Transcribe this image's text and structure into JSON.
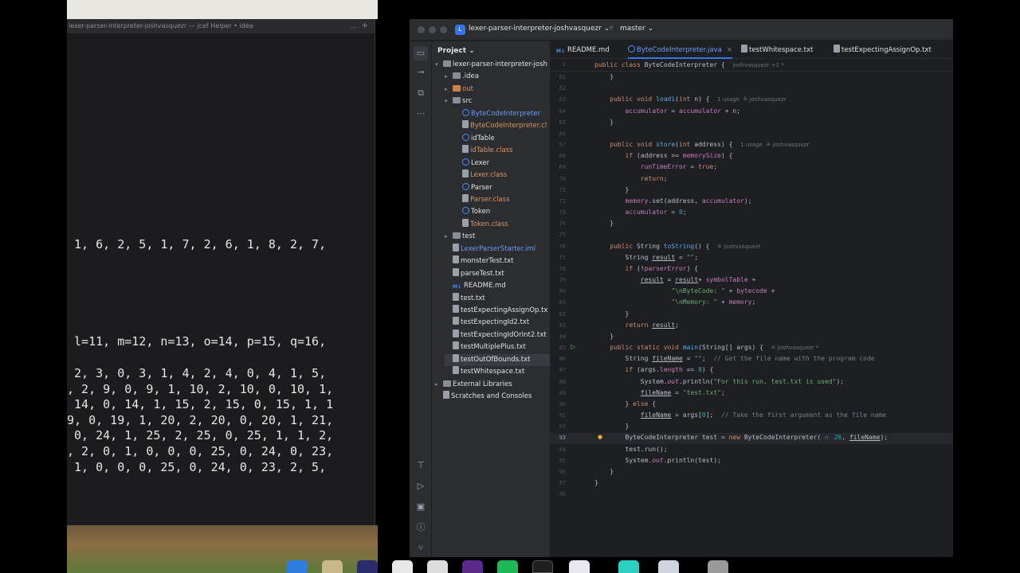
{
  "terminal": {
    "title": "lexer-parser-interpreter-joshvasquezr — jcef Helper • idea",
    "dots": "...",
    "plus": "+",
    "lines": [
      " 1, 6, 2, 5, 1, 7, 2, 6, 1, 8, 2, 7,",
      " l=11, m=12, n=13, o=14, p=15, q=16,",
      " 2, 3, 0, 3, 1, 4, 2, 4, 0, 4, 1, 5,",
      ", 2, 9, 0, 9, 1, 10, 2, 10, 0, 10, 1,",
      " 14, 0, 14, 1, 15, 2, 15, 0, 15, 1, 1",
      "9, 0, 19, 1, 20, 2, 20, 0, 20, 1, 21,",
      " 0, 24, 1, 25, 2, 25, 0, 25, 1, 1, 2,",
      ", 2, 0, 1, 0, 0, 0, 25, 0, 24, 0, 23,",
      " 1, 0, 0, 0, 25, 0, 24, 0, 23, 2, 5,"
    ]
  },
  "ide": {
    "project_badge": "L",
    "project_name": "lexer-parser-interpreter-joshvasquezr",
    "branch": "master",
    "panel_title": "Project",
    "tree": [
      {
        "label": "lexer-parser-interpreter-josh",
        "depth": 0,
        "arrow": "v",
        "icon": "folder",
        "color": "normal"
      },
      {
        "label": ".idea",
        "depth": 1,
        "arrow": ">",
        "icon": "folder",
        "color": "normal"
      },
      {
        "label": "out",
        "depth": 1,
        "arrow": ">",
        "icon": "folder-orange",
        "color": "orange"
      },
      {
        "label": "src",
        "depth": 1,
        "arrow": "v",
        "icon": "folder",
        "color": "normal"
      },
      {
        "label": "ByteCodeInterpreter",
        "depth": 2,
        "arrow": "",
        "icon": "class",
        "color": "blue"
      },
      {
        "label": "ByteCodeInterpreter.cl",
        "depth": 2,
        "arrow": "",
        "icon": "file",
        "color": "orange"
      },
      {
        "label": "idTable",
        "depth": 2,
        "arrow": "",
        "icon": "class",
        "color": "normal"
      },
      {
        "label": "idTable.class",
        "depth": 2,
        "arrow": "",
        "icon": "file",
        "color": "orange"
      },
      {
        "label": "Lexer",
        "depth": 2,
        "arrow": "",
        "icon": "class",
        "color": "normal"
      },
      {
        "label": "Lexer.class",
        "depth": 2,
        "arrow": "",
        "icon": "file",
        "color": "orange"
      },
      {
        "label": "Parser",
        "depth": 2,
        "arrow": "",
        "icon": "class",
        "color": "normal"
      },
      {
        "label": "Parser.class",
        "depth": 2,
        "arrow": "",
        "icon": "file",
        "color": "orange"
      },
      {
        "label": "Token",
        "depth": 2,
        "arrow": "",
        "icon": "class",
        "color": "normal"
      },
      {
        "label": "Token.class",
        "depth": 2,
        "arrow": "",
        "icon": "file",
        "color": "orange"
      },
      {
        "label": "test",
        "depth": 1,
        "arrow": ">",
        "icon": "folder",
        "color": "normal"
      },
      {
        "label": "LexerParserStarter.iml",
        "depth": 1,
        "arrow": "",
        "icon": "file",
        "color": "blue"
      },
      {
        "label": "monsterTest.txt",
        "depth": 1,
        "arrow": "",
        "icon": "file",
        "color": "normal"
      },
      {
        "label": "parseTest.txt",
        "depth": 1,
        "arrow": "",
        "icon": "file",
        "color": "normal"
      },
      {
        "label": "README.md",
        "depth": 1,
        "arrow": "",
        "icon": "md",
        "color": "normal"
      },
      {
        "label": "test.txt",
        "depth": 1,
        "arrow": "",
        "icon": "file",
        "color": "normal"
      },
      {
        "label": "testExpectingAssignOp.tx",
        "depth": 1,
        "arrow": "",
        "icon": "file",
        "color": "normal"
      },
      {
        "label": "testExpectingId2.txt",
        "depth": 1,
        "arrow": "",
        "icon": "file",
        "color": "normal"
      },
      {
        "label": "testExpectingIdOrInt2.txt",
        "depth": 1,
        "arrow": "",
        "icon": "file",
        "color": "normal"
      },
      {
        "label": "testMultiplePlus.txt",
        "depth": 1,
        "arrow": "",
        "icon": "file",
        "color": "normal"
      },
      {
        "label": "testOutOfBounds.txt",
        "depth": 1,
        "arrow": "",
        "icon": "file",
        "color": "normal",
        "selected": true
      },
      {
        "label": "testWhitespace.txt",
        "depth": 1,
        "arrow": "",
        "icon": "file",
        "color": "normal"
      },
      {
        "label": "External Libraries",
        "depth": 0,
        "arrow": ">",
        "icon": "library",
        "color": "normal"
      },
      {
        "label": "Scratches and Consoles",
        "depth": 0,
        "arrow": "",
        "icon": "scratch",
        "color": "normal"
      }
    ],
    "tabs": [
      {
        "label": "README.md",
        "icon": "M↓",
        "active": false
      },
      {
        "label": "ByteCodeInterpreter.java",
        "icon": "class",
        "active": true
      },
      {
        "label": "testWhitespace.txt",
        "icon": "file",
        "active": false
      },
      {
        "label": "testExpectingAssignOp.txt",
        "icon": "file",
        "active": false
      }
    ],
    "sticky_line": {
      "num": "3",
      "text": "public class ByteCodeInterpreter {",
      "hint": "joshvasquezr +1 *"
    },
    "code": [
      {
        "num": "61",
        "html": "    }"
      },
      {
        "num": "62",
        "html": ""
      },
      {
        "num": "63",
        "html": "    <span class=\"kw\">public void</span> <span class=\"fn\">loadi</span>(<span class=\"kw\">int</span> n) {  <span class=\"hint\">1 usage  ≗ joshvasquezr</span>"
      },
      {
        "num": "64",
        "html": "        <span class=\"fld\">accumulator</span> = <span class=\"fld\">accumulator</span> + n;"
      },
      {
        "num": "65",
        "html": "    }"
      },
      {
        "num": "66",
        "html": ""
      },
      {
        "num": "67",
        "html": "    <span class=\"kw\">public void</span> <span class=\"fn\">store</span>(<span class=\"kw\">int</span> address) {  <span class=\"hint\">1 usage  ≗ joshvasquezr</span>"
      },
      {
        "num": "68",
        "html": "        <span class=\"kw\">if</span> (address >= <span class=\"fld\">memorySize</span>) {"
      },
      {
        "num": "69",
        "html": "            <span class=\"fld\">runTimeError</span> = <span class=\"kw\">true</span>;"
      },
      {
        "num": "70",
        "html": "            <span class=\"kw\">return</span>;"
      },
      {
        "num": "71",
        "html": "        }"
      },
      {
        "num": "72",
        "html": "        <span class=\"fld\">memory</span>.set(address, <span class=\"fld\">accumulator</span>);"
      },
      {
        "num": "73",
        "html": "        <span class=\"fld\">accumulator</span> = <span class=\"num\">0</span>;"
      },
      {
        "num": "74",
        "html": "    }"
      },
      {
        "num": "75",
        "html": ""
      },
      {
        "num": "76",
        "html": "    <span class=\"kw\">public</span> String <span class=\"fn\">toString</span>() {  <span class=\"hint\">≗ joshvasquezr</span>"
      },
      {
        "num": "77",
        "html": "        String <span class=\"local-u\">result</span> = <span class=\"str\">\"\"</span>;"
      },
      {
        "num": "78",
        "html": "        <span class=\"kw\">if</span> (!<span class=\"fld\">parserError</span>) {"
      },
      {
        "num": "79",
        "html": "            <span class=\"local-u\">result</span> = <span class=\"local-u\">result</span>+ <span class=\"fld\">symbolTable</span> +"
      },
      {
        "num": "80",
        "html": "                    <span class=\"str\">\"\\nByteCode: \"</span> + <span class=\"fld\">bytecode</span> +"
      },
      {
        "num": "81",
        "html": "                    <span class=\"str\">\"\\nMemory: \"</span> + <span class=\"fld\">memory</span>;"
      },
      {
        "num": "82",
        "html": "        }"
      },
      {
        "num": "83",
        "html": "        <span class=\"kw\">return</span> <span class=\"local-u\">result</span>;"
      },
      {
        "num": "84",
        "html": "    }"
      },
      {
        "num": "85",
        "html": "    <span class=\"kw\">public static void</span> <span class=\"fn\">main</span>(String[] args) {  <span class=\"hint\">≗ joshvasquezr *</span>"
      },
      {
        "num": "86",
        "html": "        String <span class=\"local-u\">fileName</span> = <span class=\"str\">\"\"</span>;  <span class=\"cmt\">// Get the file name with the program code</span>"
      },
      {
        "num": "87",
        "html": "        <span class=\"kw\">if</span> (args.<span class=\"fld\">length</span> == <span class=\"num\">0</span>) {"
      },
      {
        "num": "88",
        "html": "            System.<span class=\"fld\"><i>out</i></span>.println(<span class=\"str\">\"For this run, test.txt is used\"</span>);"
      },
      {
        "num": "89",
        "html": "            <span class=\"local-u\">fileName</span> = <span class=\"str\">\"test.txt\"</span>;"
      },
      {
        "num": "90",
        "html": "        } <span class=\"kw\">else</span> {"
      },
      {
        "num": "91",
        "html": "            <span class=\"local-u\">fileName</span> = args[<span class=\"num\">0</span>];  <span class=\"cmt\">// Take the first argument as the file name</span>"
      },
      {
        "num": "92",
        "html": "        }"
      },
      {
        "num": "93",
        "html": "        ByteCodeInterpreter test = <span class=\"kw\">new</span> ByteCodeInterpreter( <span class=\"hint\">n:</span> <span class=\"num\">26</span>, <span class=\"local-u\">fileName</span>);"
      },
      {
        "num": "94",
        "html": "        test.run();"
      },
      {
        "num": "95",
        "html": "        System.<span class=\"fld\"><i>out</i></span>.println(test);"
      },
      {
        "num": "96",
        "html": "    }"
      },
      {
        "num": "97",
        "html": "}"
      },
      {
        "num": "98",
        "html": ""
      }
    ],
    "current_line": "93"
  }
}
